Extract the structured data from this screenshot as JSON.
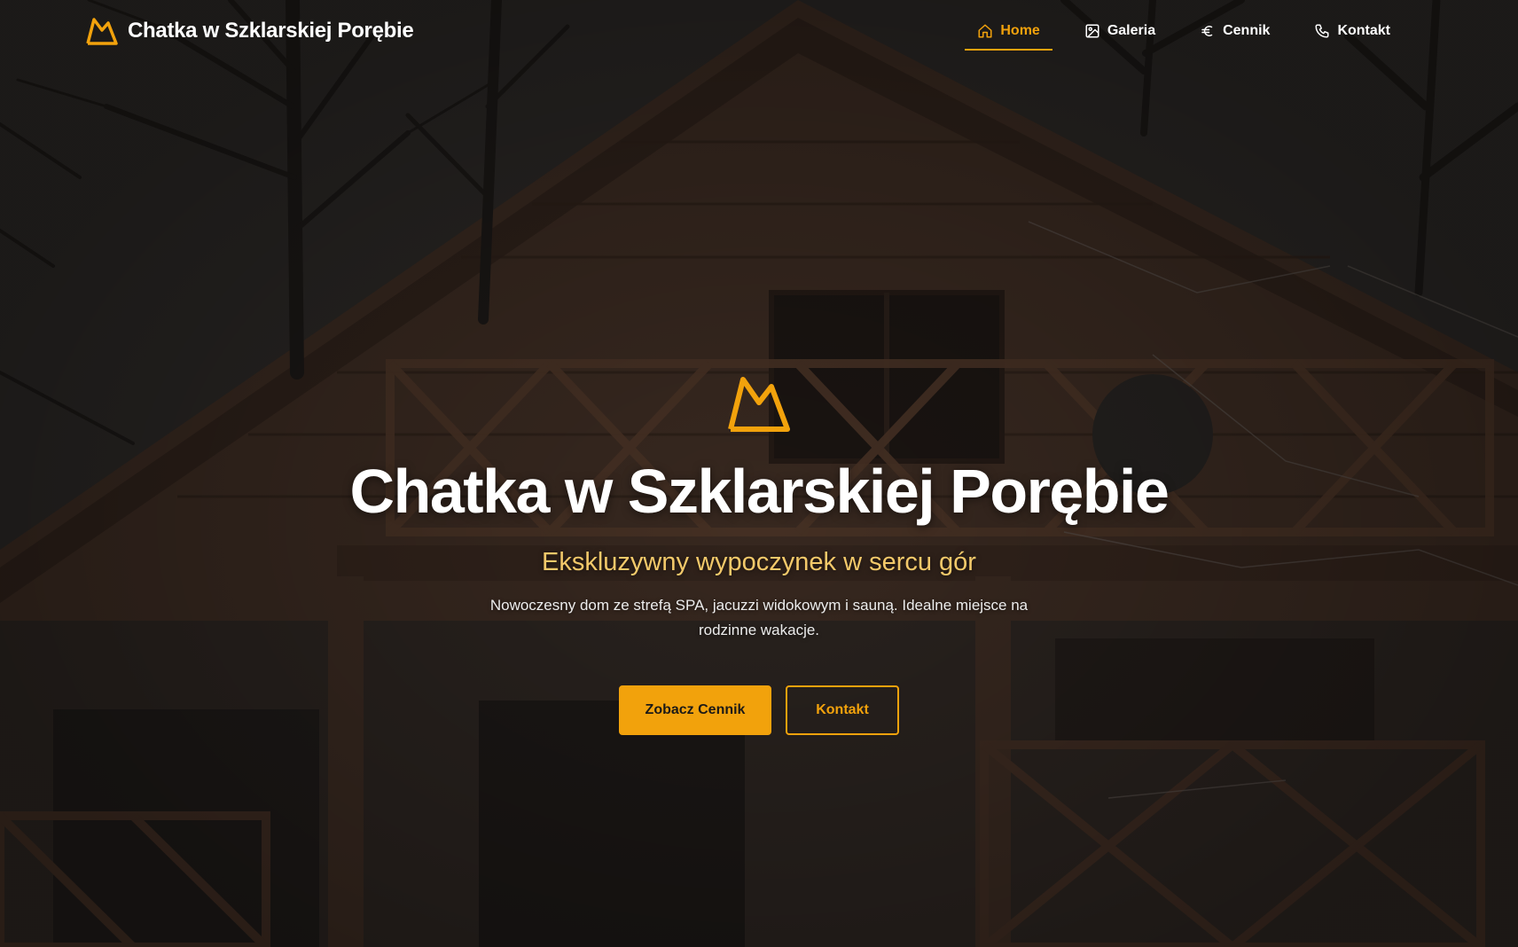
{
  "site": {
    "brand_name": "Chatka w Szklarskiej Porębie",
    "logo_icon": "mountain-crown-icon"
  },
  "nav": {
    "items": [
      {
        "label": "Home",
        "icon": "home-icon",
        "active": true
      },
      {
        "label": "Galeria",
        "icon": "image-icon",
        "active": false
      },
      {
        "label": "Cennik",
        "icon": "euro-icon",
        "active": false
      },
      {
        "label": "Kontakt",
        "icon": "phone-icon",
        "active": false
      }
    ]
  },
  "hero": {
    "title": "Chatka w Szklarskiej Porębie",
    "subtitle": "Ekskluzywny wypoczynek w sercu gór",
    "description": "Nowoczesny dom ze strefą SPA, jacuzzi widokowym i sauną. Idealne miejsce na rodzinne wakacje.",
    "primary_button": "Zobacz Cennik",
    "secondary_button": "Kontakt"
  },
  "colors": {
    "accent": "#f2a20c",
    "subtitle": "#f3c96a",
    "text": "#ffffff"
  }
}
